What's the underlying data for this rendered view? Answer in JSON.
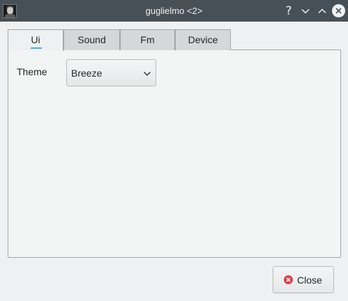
{
  "window": {
    "title": "guglielmo <2>",
    "help_label": "?"
  },
  "tabs": [
    {
      "label": "Ui",
      "active": true
    },
    {
      "label": "Sound",
      "active": false
    },
    {
      "label": "Fm",
      "active": false
    },
    {
      "label": "Device",
      "active": false
    }
  ],
  "ui_tab": {
    "theme_label": "Theme",
    "theme_value": "Breeze"
  },
  "footer": {
    "close_label": "Close"
  },
  "colors": {
    "titlebar": "#475057",
    "accent": "#3daee9",
    "close_icon": "#da4453"
  }
}
